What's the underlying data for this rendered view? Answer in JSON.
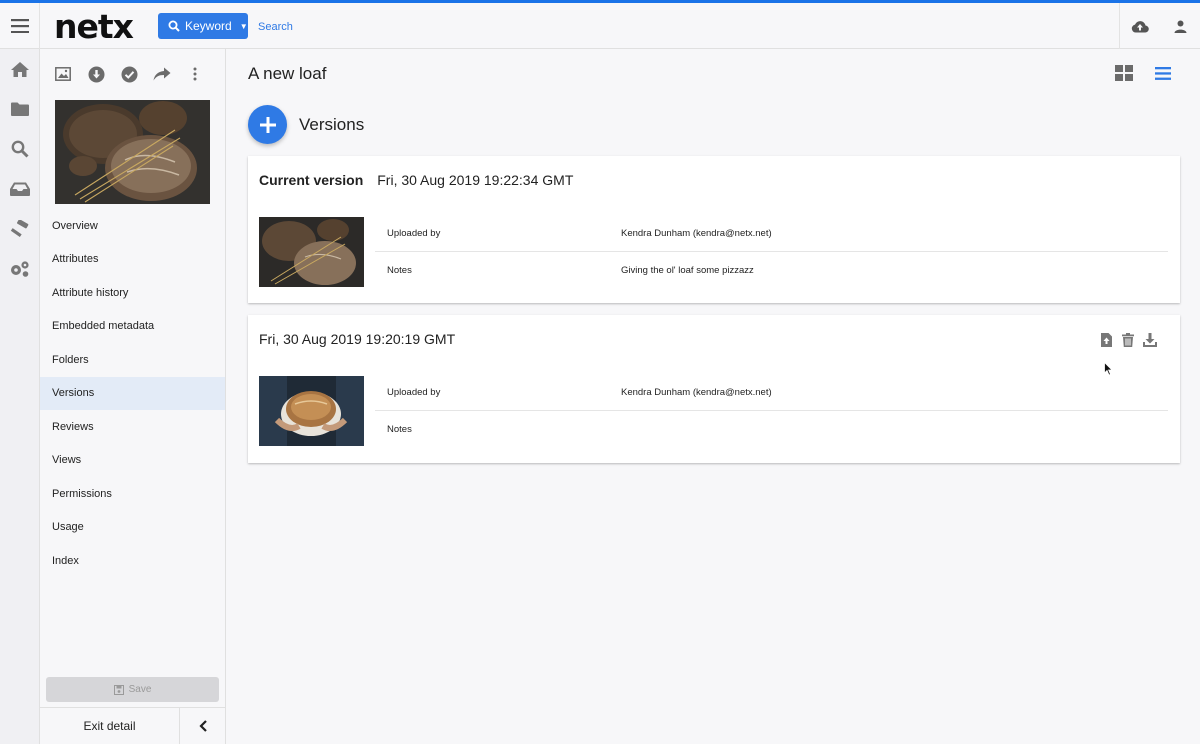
{
  "header": {
    "logo": "netx",
    "search_type_label": "Keyword",
    "search_placeholder": "Search"
  },
  "rail": [
    "home-icon",
    "folder-icon",
    "search-icon",
    "inbox-icon",
    "hammer-icon",
    "gears-icon"
  ],
  "detail": {
    "tools": [
      "image-icon",
      "download-circle-icon",
      "check-circle-icon",
      "share-icon",
      "more-vert-icon"
    ],
    "nav": [
      {
        "label": "Overview"
      },
      {
        "label": "Attributes"
      },
      {
        "label": "Attribute history"
      },
      {
        "label": "Embedded metadata"
      },
      {
        "label": "Folders"
      },
      {
        "label": "Versions",
        "active": true
      },
      {
        "label": "Reviews"
      },
      {
        "label": "Views"
      },
      {
        "label": "Permissions"
      },
      {
        "label": "Usage"
      },
      {
        "label": "Index"
      }
    ],
    "save_label": "Save",
    "exit_label": "Exit detail"
  },
  "main": {
    "page_title": "A new loaf",
    "section_title": "Versions",
    "versions": [
      {
        "label": "Current version",
        "date": "Fri, 30 Aug 2019 19:22:34 GMT",
        "uploaded_by_label": "Uploaded by",
        "uploaded_by": "Kendra Dunham (kendra@netx.net)",
        "notes_label": "Notes",
        "notes": "Giving the ol' loaf some pizzazz"
      },
      {
        "label": "",
        "date": "Fri, 30 Aug 2019 19:20:19 GMT",
        "uploaded_by_label": "Uploaded by",
        "uploaded_by": "Kendra Dunham (kendra@netx.net)",
        "notes_label": "Notes",
        "notes": ""
      }
    ]
  },
  "colors": {
    "accent": "#2f7ae5",
    "active_nav_bg": "#e3ebf7",
    "icon_gray": "#6b6b6b"
  }
}
